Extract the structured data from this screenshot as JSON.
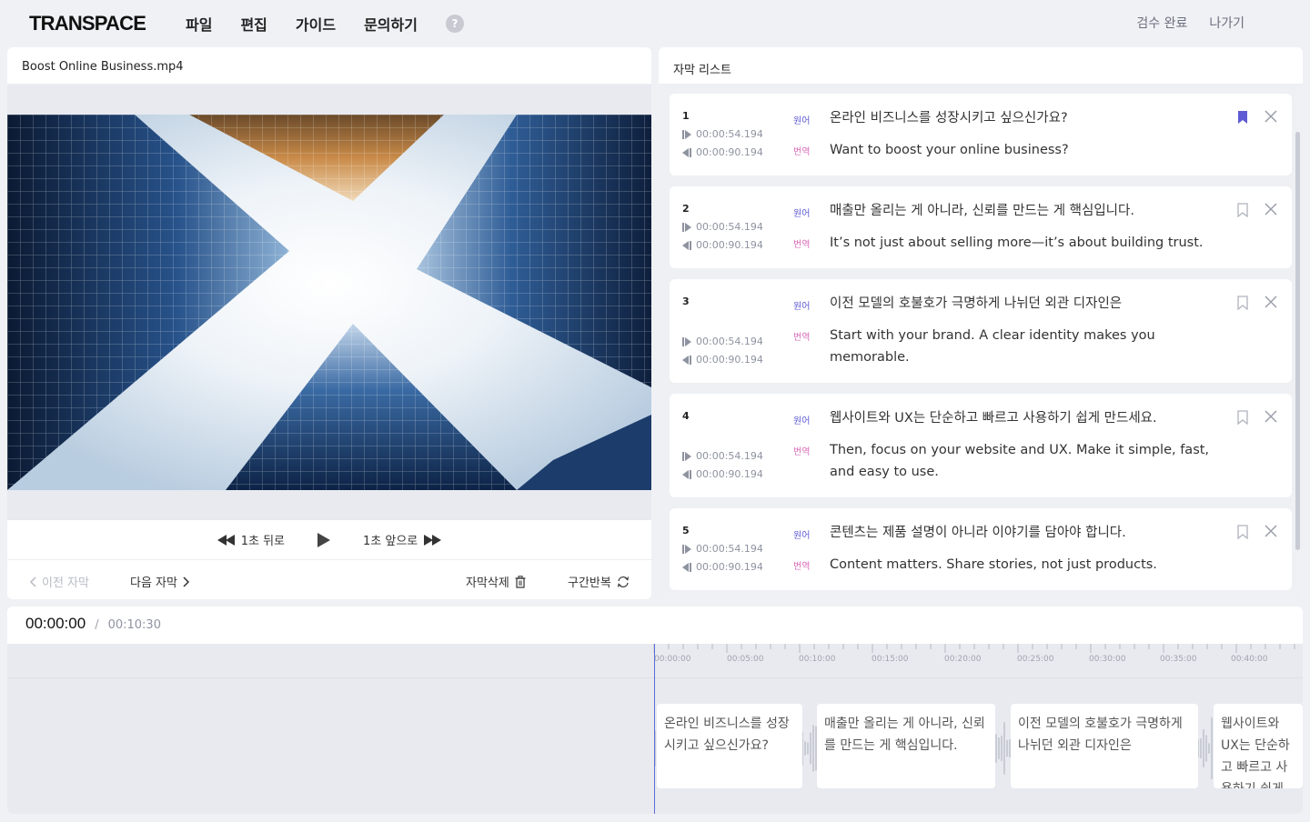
{
  "app": {
    "logo": "TRANSPACE",
    "menu": [
      "파일",
      "편집",
      "가이드",
      "문의하기"
    ],
    "help": "?",
    "actions": {
      "review_done": "검수 완료",
      "exit": "나가기"
    }
  },
  "video": {
    "filename": "Boost Online Business.mp4",
    "back_label": "1초 뒤로",
    "forward_label": "1초 앞으로",
    "prev_sub": "이전 자막",
    "next_sub": "다음 자막",
    "delete_sub": "자막삭제",
    "repeat": "구간반복"
  },
  "subtitles": {
    "title": "자막 리스트",
    "source_label": "원어",
    "target_label": "번역",
    "items": [
      {
        "num": "1",
        "start": "00:00:54.194",
        "end": "00:00:90.194",
        "source": "온라인 비즈니스를 성장시키고 싶으신가요?",
        "target": "Want to boost your online business?",
        "bookmarked": true
      },
      {
        "num": "2",
        "start": "00:00:54.194",
        "end": "00:00:90.194",
        "source": "매출만 올리는 게 아니라, 신뢰를 만드는 게 핵심입니다.",
        "target": "It’s not just about selling more—it’s about building trust.",
        "bookmarked": false
      },
      {
        "num": "3",
        "start": "00:00:54.194",
        "end": "00:00:90.194",
        "source": "이전 모델의 호불호가 극명하게 나뉘던 외관 디자인은",
        "target": "Start with your brand. A clear identity makes you memorable.",
        "bookmarked": false
      },
      {
        "num": "4",
        "start": "00:00:54.194",
        "end": "00:00:90.194",
        "source": "웹사이트와 UX는 단순하고 빠르고 사용하기 쉽게 만드세요.",
        "target": "Then, focus on your website and UX. Make it simple, fast, and easy to use.",
        "bookmarked": false
      },
      {
        "num": "5",
        "start": "00:00:54.194",
        "end": "00:00:90.194",
        "source": "콘텐츠는 제품 설명이 아니라 이야기를 담아야 합니다.",
        "target": "Content matters. Share stories, not just products.",
        "bookmarked": false
      }
    ]
  },
  "timeline": {
    "current": "00:00:00",
    "separator": "/",
    "total": "00:10:30",
    "ticks": [
      "00:00:00",
      "00:05:00",
      "00:10:00",
      "00:15:00",
      "00:20:00",
      "00:25:00",
      "00:30:00",
      "00:35:00",
      "00:40:00"
    ],
    "clips": [
      "온라인 비즈니스를 성장시키고 싶으신가요?",
      "매출만 올리는 게 아니라, 신뢰를 만드는 게 핵심입니다.",
      "이전 모델의 호불호가 극명하게 나뉘던 외관 디자인은",
      "웹사이트와 UX는 단순하고 빠르고 사용하기 쉽게 만드세요."
    ]
  },
  "colors": {
    "accent": "#5f5bd4",
    "translation": "#d86ab8",
    "playhead": "#5a6fd8"
  }
}
